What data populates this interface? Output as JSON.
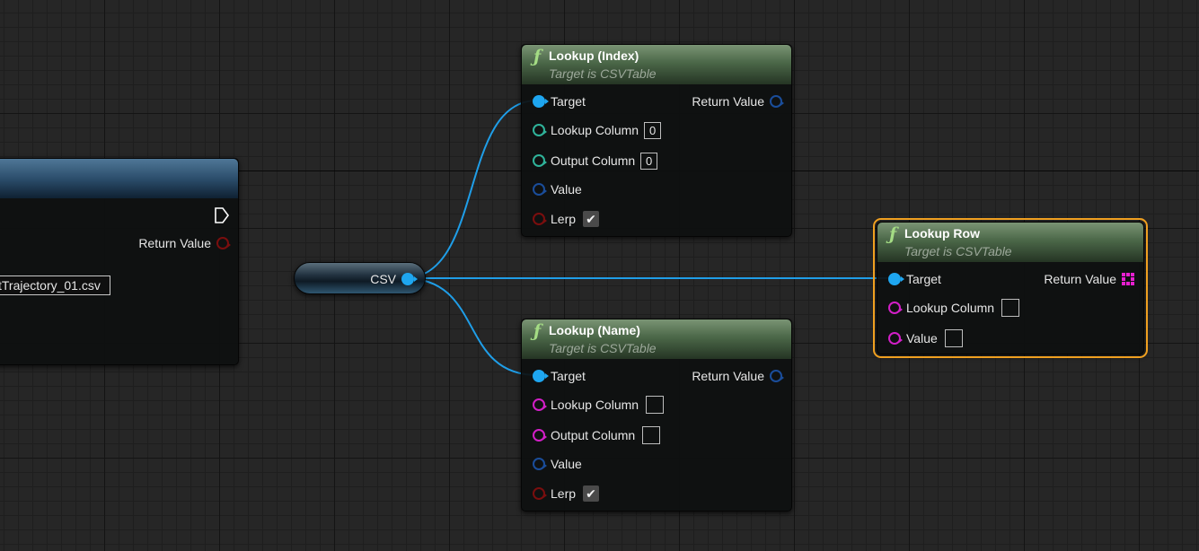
{
  "left_node": {
    "return_label": "Return Value",
    "file_value": "tTrajectory_01.csv"
  },
  "csv_node": {
    "label": "CSV"
  },
  "lookup_index": {
    "title": "Lookup (Index)",
    "subtitle": "Target is CSVTable",
    "target_label": "Target",
    "return_label": "Return Value",
    "lookup_column_label": "Lookup Column",
    "lookup_column_value": "0",
    "output_column_label": "Output Column",
    "output_column_value": "0",
    "value_label": "Value",
    "lerp_label": "Lerp",
    "lerp_checked": true
  },
  "lookup_name": {
    "title": "Lookup (Name)",
    "subtitle": "Target is CSVTable",
    "target_label": "Target",
    "return_label": "Return Value",
    "lookup_column_label": "Lookup Column",
    "output_column_label": "Output Column",
    "value_label": "Value",
    "lerp_label": "Lerp",
    "lerp_checked": true
  },
  "lookup_row": {
    "title": "Lookup Row",
    "subtitle": "Target is CSVTable",
    "target_label": "Target",
    "return_label": "Return Value",
    "lookup_column_label": "Lookup Column",
    "value_label": "Value",
    "selected": true
  },
  "icons": {
    "function": "function-icon",
    "exec": "exec-pin-icon",
    "array": "array-grid-icon",
    "check": "✔"
  },
  "colors": {
    "wire": "#1f9ee8",
    "selection": "#f0a020",
    "function_header": "#4b6748",
    "object_pin": "#1ea6f0",
    "string_pin": "#d21fc7",
    "int_pin": "#2fb39a",
    "bool_pin": "#7a0e0e"
  }
}
